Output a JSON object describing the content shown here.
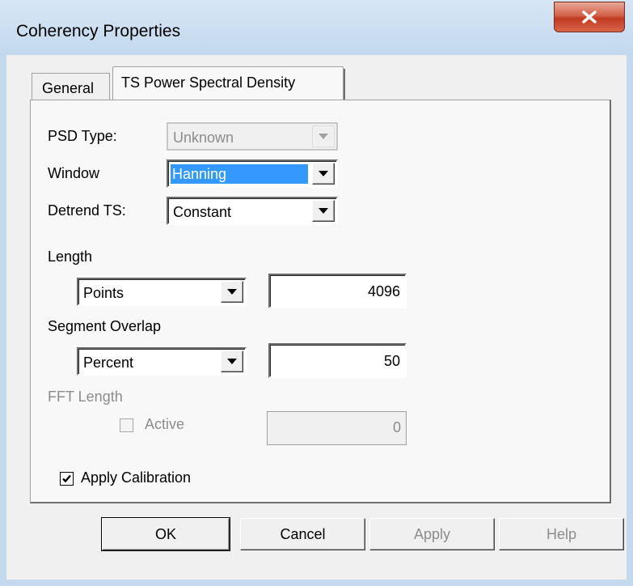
{
  "window": {
    "title": "Coherency Properties",
    "close_icon": "close-icon"
  },
  "tabs": [
    {
      "label": "General",
      "selected": false
    },
    {
      "label": "TS Power Spectral Density",
      "selected": true
    }
  ],
  "psd_type": {
    "label": "PSD Type:",
    "value": "Unknown",
    "enabled": false
  },
  "window_fn": {
    "label": "Window",
    "value": "Hanning",
    "highlighted": true
  },
  "detrend": {
    "label": "Detrend TS:",
    "value": "Constant"
  },
  "length": {
    "label": "Length",
    "unit": "Points",
    "value": "4096"
  },
  "overlap": {
    "label": "Segment Overlap",
    "unit": "Percent",
    "value": "50"
  },
  "fft": {
    "label": "FFT Length",
    "active_label": "Active",
    "active_checked": false,
    "enabled": false,
    "value": "0"
  },
  "calibration": {
    "label": "Apply Calibration",
    "checked": true
  },
  "buttons": {
    "ok": "OK",
    "cancel": "Cancel",
    "apply": "Apply",
    "help": "Help"
  },
  "colors": {
    "selection": "#3399ff",
    "close_button": "#c13a22"
  }
}
